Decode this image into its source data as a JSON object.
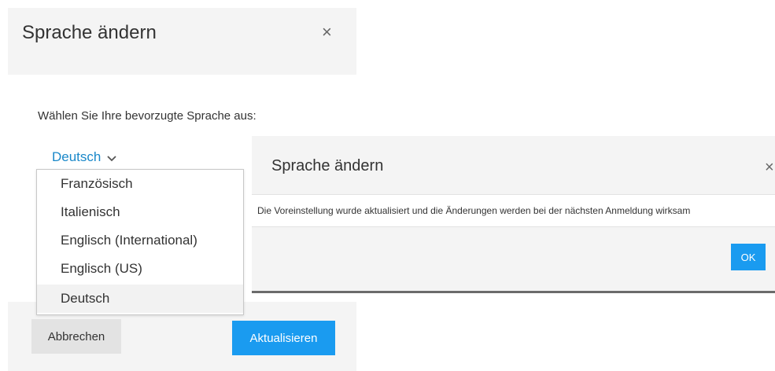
{
  "dialog1": {
    "title": "Sprache ändern",
    "close_glyph": "×",
    "prompt": "Wählen Sie Ihre bevorzugte Sprache aus:",
    "selected_language": "Deutsch",
    "dropdown_options": [
      "Französisch",
      "Italienisch",
      "Englisch (International)",
      "Englisch (US)",
      "Deutsch"
    ],
    "highlighted_option": "Deutsch",
    "cancel_label": "Abbrechen",
    "update_label": "Aktualisieren"
  },
  "dialog2": {
    "title": "Sprache ändern",
    "close_glyph": "×",
    "message": "Die Voreinstellung wurde aktualisiert und die Änderungen werden bei der nächsten Anmeldung wirksam",
    "ok_label": "OK"
  },
  "icons": {
    "language_select_chevron": "chevron-down-icon",
    "dialog_close": "close-icon"
  },
  "colors": {
    "link_blue": "#1a88c9",
    "primary_button": "#1a9bf0",
    "header_background": "#f4f4f4",
    "cancel_button": "#e3e3e3"
  }
}
